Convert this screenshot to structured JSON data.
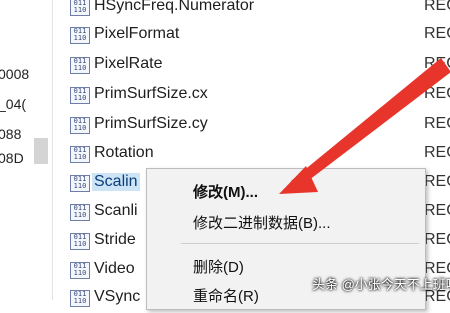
{
  "tree": {
    "items": [
      {
        "label": "0008"
      },
      {
        "label": "_04("
      },
      {
        "label": "088"
      },
      {
        "label": "08D"
      }
    ]
  },
  "values": [
    {
      "name": "HSyncFreq.Numerator",
      "type": "REG"
    },
    {
      "name": "PixelFormat",
      "type": "REG"
    },
    {
      "name": "PixelRate",
      "type": "REG"
    },
    {
      "name": "PrimSurfSize.cx",
      "type": "REG"
    },
    {
      "name": "PrimSurfSize.cy",
      "type": "REG"
    },
    {
      "name": "Rotation",
      "type": "REG"
    },
    {
      "name": "Scalin",
      "type": "REG",
      "selected": true
    },
    {
      "name": "Scanli",
      "type": "REG"
    },
    {
      "name": "Stride",
      "type": "REG"
    },
    {
      "name": "Video",
      "type": "REG"
    },
    {
      "name": "VSync",
      "type": "REG"
    }
  ],
  "context_menu": {
    "modify": "修改(M)...",
    "modify_binary": "修改二进制数据(B)...",
    "delete": "删除(D)",
    "rename": "重命名(R)"
  },
  "icon_glyph": "011\n110",
  "watermark": "头条 @小张今天不上班呐",
  "colors": {
    "arrow": "#e8352c",
    "selection": "#cde4f7"
  }
}
